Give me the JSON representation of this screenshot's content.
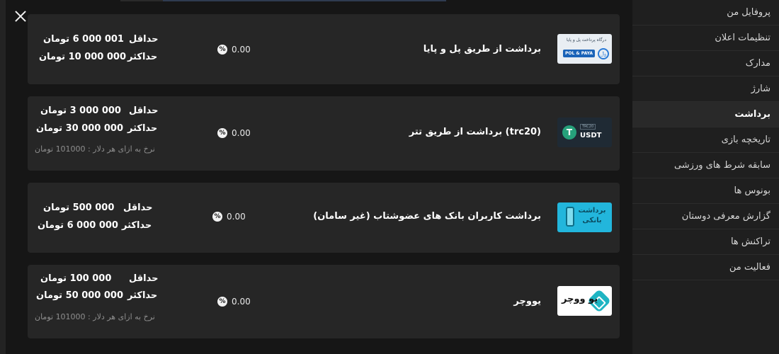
{
  "sidebar": {
    "items": [
      {
        "label": "پروفایل من",
        "active": false
      },
      {
        "label": "تنظیمات اعلان",
        "active": false
      },
      {
        "label": "مدارک",
        "active": false
      },
      {
        "label": "شارژ",
        "active": false
      },
      {
        "label": "برداشت",
        "active": true
      },
      {
        "label": "تاریخچه بازی",
        "active": false
      },
      {
        "label": "سابقه شرط های ورزشی",
        "active": false
      },
      {
        "label": "بونوس ها",
        "active": false
      },
      {
        "label": "گزارش معرفی دوستان",
        "active": false
      },
      {
        "label": "تراکنش ها",
        "active": false
      },
      {
        "label": "فعالیت من",
        "active": false
      }
    ]
  },
  "methods": [
    {
      "title": "برداشت از طریق پل و پایا",
      "fee": "0.00",
      "min_label": "حداقل",
      "min_value": "001 000 6 تومان",
      "max_label": "حداکثر",
      "max_value": "000 000 10 تومان",
      "rate": "",
      "logo": {
        "caption": "درگاه پرداخت پل و پایا",
        "badge": "POL & PAYA",
        "mark": "﷼"
      }
    },
    {
      "title": "(trc20) برداشت از طریق تتر",
      "fee": "0.00",
      "min_label": "حداقل",
      "min_value": "000 000 3 تومان",
      "max_label": "حداکثر",
      "max_value": "000 000 30 تومان",
      "rate": "نرخ به ازای هر دلار : 101000 تومان",
      "logo": {
        "mark": "T",
        "badge": "TRC20",
        "caption": "USDT"
      }
    },
    {
      "title": "برداشت کاربران بانک های عضوشتاب (غیر سامان)",
      "fee": "0.00",
      "min_label": "حداقل",
      "min_value": "000 500 تومان",
      "max_label": "حداکثر",
      "max_value": "000 000 6 تومان",
      "rate": "",
      "logo": {
        "caption": "برداشت بانکی"
      }
    },
    {
      "title": "یووچر",
      "fee": "0.00",
      "min_label": "حداقل",
      "min_value": "000 100 تومان",
      "max_label": "حداکثر",
      "max_value": "000 000 50 تومان",
      "rate": "نرخ به ازای هر دلار : 101000 تومان",
      "logo": {
        "caption": "یو ووچر"
      }
    }
  ],
  "icons": {
    "close": "close-icon",
    "fee": "percent-icon"
  },
  "colors": {
    "background": "#161616",
    "card": "#262626",
    "sidebar": "#1f1f1f",
    "active_item": "#292929",
    "muted_text": "#8e8e8e"
  }
}
